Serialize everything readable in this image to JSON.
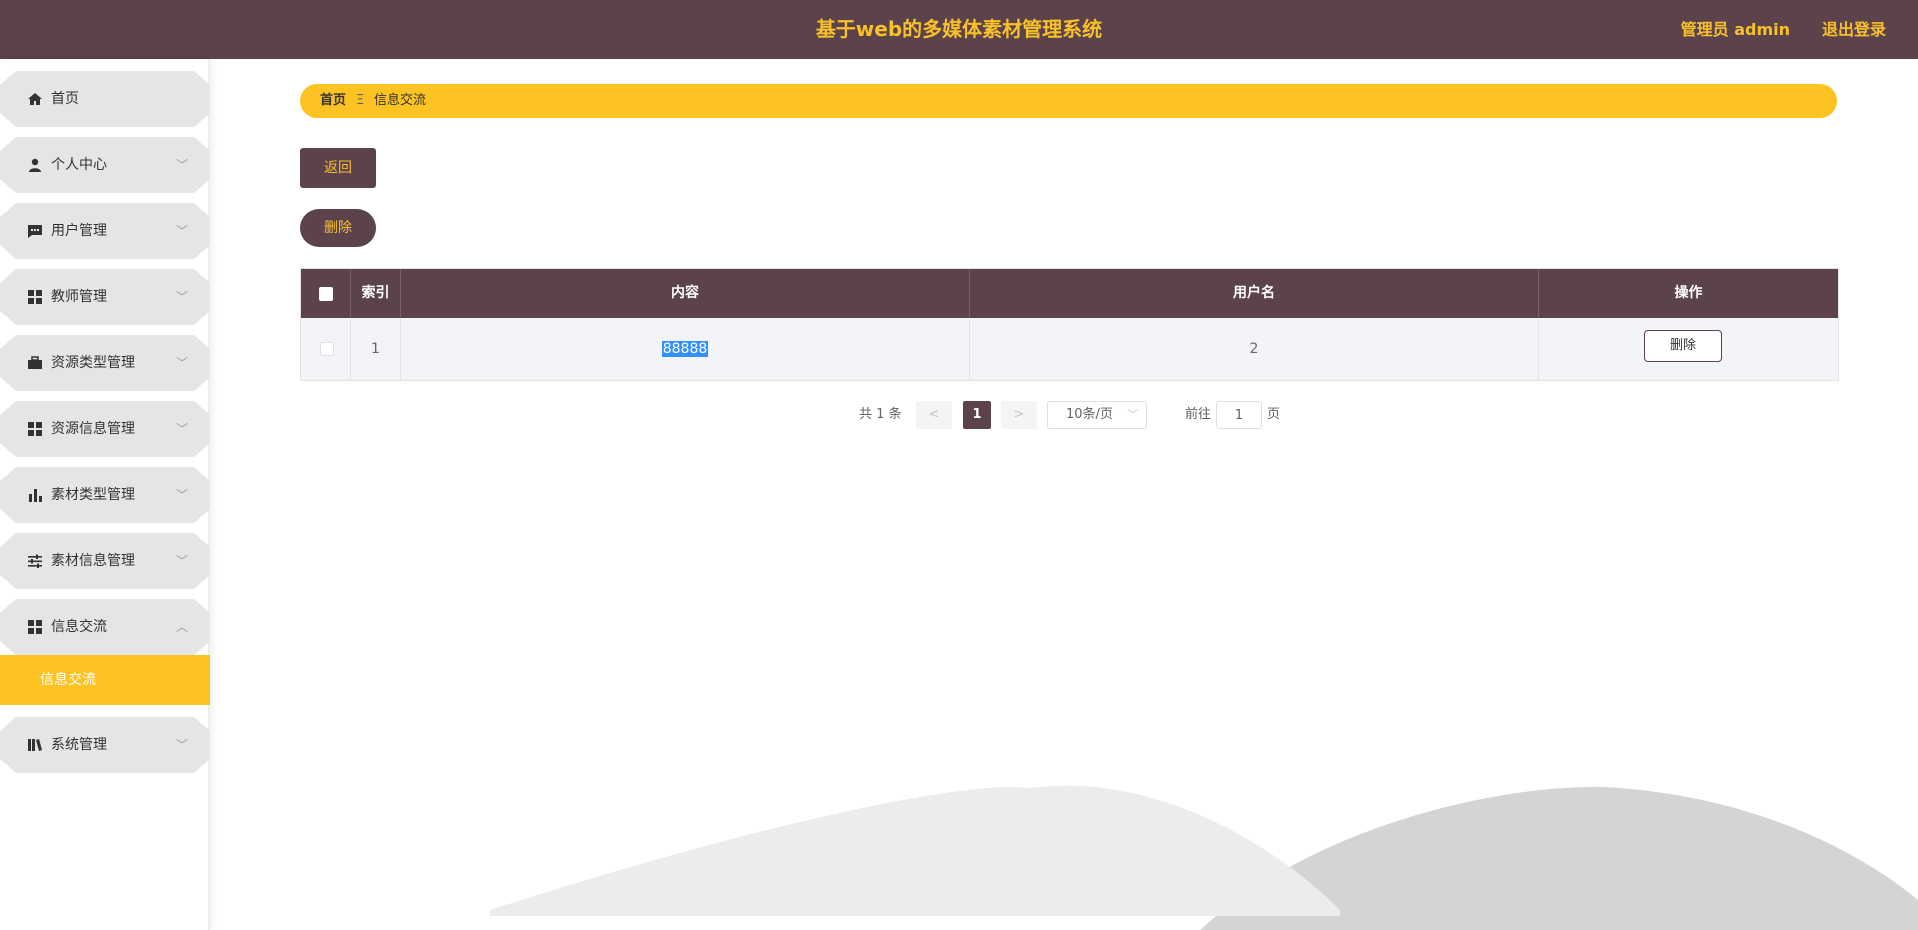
{
  "header": {
    "title": "基于web的多媒体素材管理系统",
    "user_label": "管理员 admin",
    "logout_label": "退出登录"
  },
  "sidebar": {
    "items": [
      {
        "label": "首页",
        "icon": "home-icon"
      },
      {
        "label": "个人中心",
        "icon": "person-icon"
      },
      {
        "label": "用户管理",
        "icon": "chat-icon"
      },
      {
        "label": "教师管理",
        "icon": "grid-icon"
      },
      {
        "label": "资源类型管理",
        "icon": "briefcase-icon"
      },
      {
        "label": "资源信息管理",
        "icon": "grid-icon"
      },
      {
        "label": "素材类型管理",
        "icon": "bar-chart-icon"
      },
      {
        "label": "素材信息管理",
        "icon": "sliders-icon"
      },
      {
        "label": "信息交流",
        "icon": "grid-icon"
      },
      {
        "label": "系统管理",
        "icon": "book-icon"
      }
    ],
    "active_sub": "信息交流"
  },
  "breadcrumb": {
    "home": "首页",
    "separator": "Ξ",
    "current": "信息交流"
  },
  "actions": {
    "back_label": "返回",
    "delete_label": "删除"
  },
  "table": {
    "columns": [
      "索引",
      "内容",
      "用户名",
      "操作"
    ],
    "rows": [
      {
        "index": "1",
        "content": "88888",
        "username": "2",
        "action": "删除"
      }
    ]
  },
  "pagination": {
    "total_text": "共 1 条",
    "prev": "<",
    "next": ">",
    "current_page": "1",
    "page_size": "10条/页",
    "goto_label": "前往",
    "goto_value": "1",
    "page_unit": "页"
  },
  "colors": {
    "primary": "#5b424b",
    "accent": "#fcc323",
    "title_text": "#f8c12a"
  }
}
